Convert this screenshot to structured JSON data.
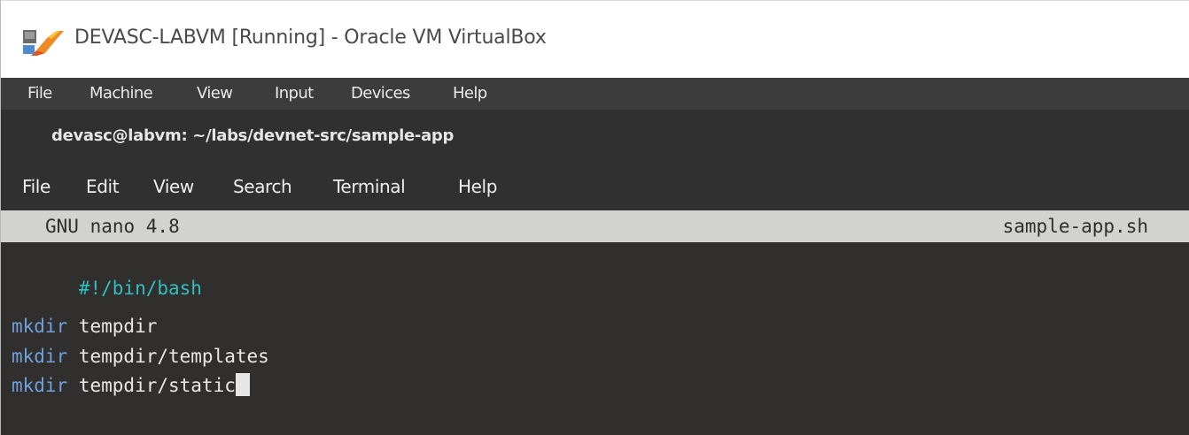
{
  "window": {
    "title": "DEVASC-LABVM [Running] - Oracle VM VirtualBox",
    "app_icon": "virtualbox-icon"
  },
  "vm_menu": {
    "items": [
      "File",
      "Machine",
      "View",
      "Input",
      "Devices",
      "Help"
    ]
  },
  "terminal": {
    "title": "devasc@labvm: ~/labs/devnet-src/sample-app",
    "menu": [
      "File",
      "Edit",
      "View",
      "Search",
      "Terminal",
      "Help"
    ]
  },
  "nano": {
    "version": "GNU nano 4.8",
    "filename": "sample-app.sh",
    "lines": [
      {
        "type": "comment",
        "text": "#!/bin/bash"
      },
      {
        "type": "blank",
        "text": ""
      },
      {
        "type": "command",
        "keyword": "mkdir",
        "arg": " tempdir"
      },
      {
        "type": "command",
        "keyword": "mkdir",
        "arg": " tempdir/templates"
      },
      {
        "type": "command",
        "keyword": "mkdir",
        "arg": " tempdir/static"
      }
    ]
  },
  "colors": {
    "comment": "#2fbfbf",
    "keyword": "#6fa0dc",
    "terminal_bg": "#302f2d",
    "nano_header_bg": "#d2d2d0"
  }
}
